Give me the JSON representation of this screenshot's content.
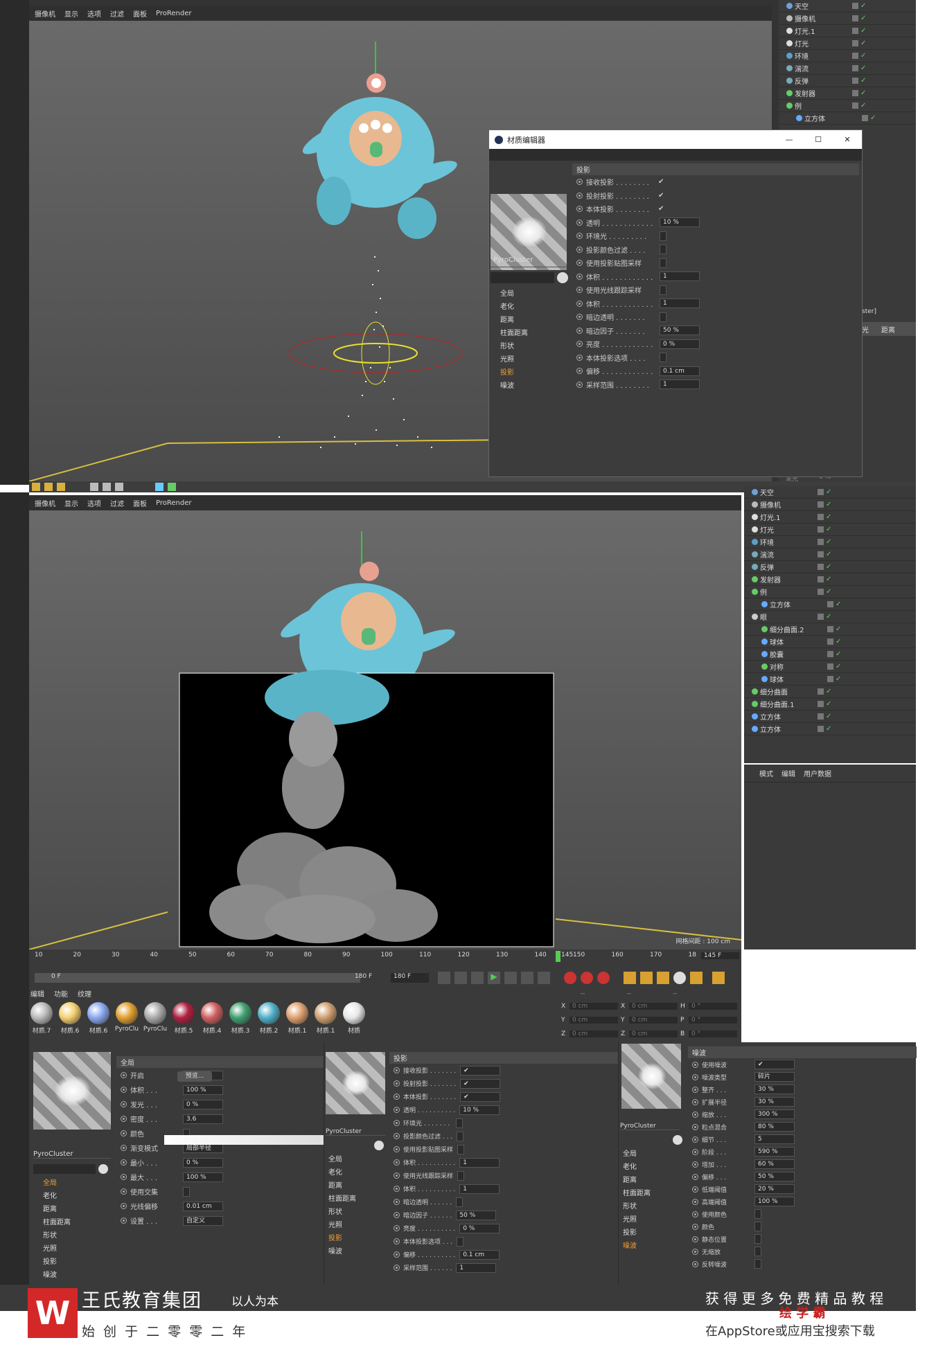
{
  "menu": [
    "摄像机",
    "显示",
    "选项",
    "过滤",
    "面板",
    "ProRender"
  ],
  "objects_top": [
    {
      "name": "天空",
      "color": "#6fa0d8"
    },
    {
      "name": "摄像机",
      "color": "#bbbbbb"
    },
    {
      "name": "灯光.1",
      "color": "#dddddd"
    },
    {
      "name": "灯光",
      "color": "#dddddd"
    },
    {
      "name": "环境",
      "color": "#5aa0c8"
    },
    {
      "name": "湍流",
      "color": "#7ab"
    },
    {
      "name": "反弹",
      "color": "#7ab"
    },
    {
      "name": "发射器",
      "color": "#6c6"
    },
    {
      "name": "例",
      "color": "#6c6"
    },
    {
      "name": "立方体",
      "color": "#6af"
    }
  ],
  "objects_bottom": [
    {
      "name": "天空",
      "color": "#6fa0d8"
    },
    {
      "name": "摄像机",
      "color": "#bbbbbb"
    },
    {
      "name": "灯光.1",
      "color": "#dddddd"
    },
    {
      "name": "灯光",
      "color": "#dddddd"
    },
    {
      "name": "环境",
      "color": "#5aa0c8"
    },
    {
      "name": "湍流",
      "color": "#7ab"
    },
    {
      "name": "反弹",
      "color": "#7ab"
    },
    {
      "name": "发射器",
      "color": "#6c6"
    },
    {
      "name": "例",
      "color": "#6c6"
    },
    {
      "name": "立方体",
      "color": "#6af"
    },
    {
      "name": "眼",
      "color": "#ccc"
    },
    {
      "name": "细分曲面.2",
      "color": "#6c6"
    },
    {
      "name": "球体",
      "color": "#6af"
    },
    {
      "name": "胶囊",
      "color": "#6af"
    },
    {
      "name": "对称",
      "color": "#6c6"
    },
    {
      "name": "球体",
      "color": "#6af"
    },
    {
      "name": "细分曲面",
      "color": "#6c6"
    },
    {
      "name": "细分曲面.1",
      "color": "#6c6"
    },
    {
      "name": "立方体",
      "color": "#6af"
    },
    {
      "name": "立方体",
      "color": "#6af"
    }
  ],
  "partial_labels": {
    "ster": "ster]",
    "guang": "光",
    "ju": "距离",
    "dist": "距离",
    "fa": "发光",
    "pct": "0 %"
  },
  "mat_editor": {
    "title": "材质编辑器",
    "material_name": "PyroCluster",
    "channels": [
      "全局",
      "老化",
      "距离",
      "柱面距离",
      "形状",
      "光照",
      "投影",
      "噪波"
    ],
    "active_channel": "投影",
    "section": "投影",
    "rows": [
      {
        "label": "接收投影 . . . . . . . .",
        "check": "✔"
      },
      {
        "label": "投射投影 . . . . . . . .",
        "check": "✔"
      },
      {
        "label": "本体投影 . . . . . . . .",
        "check": "✔"
      },
      {
        "label": "透明 . . . . . . . . . . . .",
        "value": "10 %"
      },
      {
        "label": "环境光 . . . . . . . . .",
        "value": ""
      },
      {
        "label": "投影颜色过滤 . . . .",
        "value": ""
      },
      {
        "label": "使用投影贴图采样",
        "value": ""
      },
      {
        "label": "体积 . . . . . . . . . . . .",
        "value": "1"
      },
      {
        "label": "使用光线跟踪采样",
        "value": ""
      },
      {
        "label": "体积 . . . . . . . . . . . .",
        "value": "1"
      },
      {
        "label": "暗边透明 . . . . . . .",
        "value": ""
      },
      {
        "label": "暗边因子 . . . . . . .",
        "value": "50 %"
      },
      {
        "label": "亮度 . . . . . . . . . . . .",
        "value": "0 %"
      },
      {
        "label": "本体投影选项 . . . .",
        "value": ""
      },
      {
        "label": "偏移 . . . . . . . . . . . .",
        "value": "0.1 cm"
      },
      {
        "label": "采样范围 . . . . . . . .",
        "value": "1"
      }
    ]
  },
  "viewport_bottom": {
    "grid_label": "网格间距 : 100 cm"
  },
  "attr_tabs": [
    "模式",
    "编辑",
    "用户数据"
  ],
  "timeline": {
    "ticks": [
      "10",
      "20",
      "30",
      "40",
      "50",
      "60",
      "70",
      "80",
      "90",
      "100",
      "110",
      "120",
      "130",
      "140",
      "150",
      "160",
      "170",
      "18"
    ],
    "marker": "145",
    "current": "0 F",
    "end": "180 F",
    "end2": "180 F",
    "frame_display": "145 F"
  },
  "coords": {
    "rows": [
      {
        "a": "X",
        "av": "0 cm",
        "b": "X",
        "bv": "0 cm",
        "c": "H",
        "cv": "0 °"
      },
      {
        "a": "Y",
        "av": "0 cm",
        "b": "Y",
        "bv": "0 cm",
        "c": "P",
        "cv": "0 °"
      },
      {
        "a": "Z",
        "av": "0 cm",
        "b": "Z",
        "bv": "0 cm",
        "c": "B",
        "cv": "0 °"
      }
    ],
    "header": [
      "--",
      "--",
      "--"
    ]
  },
  "mat_menu": [
    "编辑",
    "功能",
    "纹理"
  ],
  "materials": [
    {
      "name": "材质.7",
      "color": "#bbbbbb"
    },
    {
      "name": "材质.6",
      "color": "#f5d070"
    },
    {
      "name": "材质.6",
      "color": "#8aa8f0"
    },
    {
      "name": "PyroClu",
      "color": "#e0a030"
    },
    {
      "name": "PyroClu",
      "color": "#aaaaaa"
    },
    {
      "name": "材质.5",
      "color": "#b02040"
    },
    {
      "name": "材质.4",
      "color": "#d06060"
    },
    {
      "name": "材质.3",
      "color": "#40a070"
    },
    {
      "name": "材质.2",
      "color": "#50b0c8"
    },
    {
      "name": "材质.1",
      "color": "#e0a070"
    },
    {
      "name": "材质.1",
      "color": "#d0a070"
    },
    {
      "name": "材质",
      "color": "#e8e8e8"
    }
  ],
  "panel1": {
    "name": "PyroCluster",
    "section": "全局",
    "channels": [
      "全局",
      "老化",
      "距离",
      "柱面距离",
      "形状",
      "光照",
      "投影",
      "噪波"
    ],
    "active": "全局",
    "preview_btn": "预览...",
    "rows": [
      {
        "label": "开启",
        "value": "✔"
      },
      {
        "label": "体积 . . .",
        "value": "100 %"
      },
      {
        "label": "发光 . . .",
        "value": "0 %"
      },
      {
        "label": "密度 . . .",
        "value": "3.6"
      },
      {
        "label": "颜色",
        "value": ""
      },
      {
        "label": "渐变模式",
        "value": "局部半径"
      },
      {
        "label": "最小 . . .",
        "value": "0 %"
      },
      {
        "label": "最大 . . .",
        "value": "100 %"
      },
      {
        "label": "使用交集",
        "value": ""
      },
      {
        "label": "光线偏移",
        "value": "0.01 cm"
      },
      {
        "label": "设置 . . .",
        "value": "自定义"
      }
    ]
  },
  "panel2": {
    "name": "PyroCluster",
    "section": "投影",
    "channels": [
      "全局",
      "老化",
      "距离",
      "柱面距离",
      "形状",
      "光照",
      "投影",
      "噪波"
    ],
    "active": "投影",
    "rows": [
      {
        "label": "接收投影 . . . . . . .",
        "value": "✔"
      },
      {
        "label": "投射投影 . . . . . . .",
        "value": "✔"
      },
      {
        "label": "本体投影 . . . . . . .",
        "value": "✔"
      },
      {
        "label": "透明 . . . . . . . . . .",
        "value": "10 %"
      },
      {
        "label": "环境光 . . . . . . .",
        "value": ""
      },
      {
        "label": "投影颜色过滤 . . .",
        "value": ""
      },
      {
        "label": "使用投影贴图采样",
        "value": ""
      },
      {
        "label": "体积 . . . . . . . . . .",
        "value": "1"
      },
      {
        "label": "使用光线跟踪采样",
        "value": ""
      },
      {
        "label": "体积 . . . . . . . . . .",
        "value": "1"
      },
      {
        "label": "暗边透明 . . . . . .",
        "value": ""
      },
      {
        "label": "暗边因子 . . . . . .",
        "value": "50 %"
      },
      {
        "label": "亮度 . . . . . . . . . .",
        "value": "0 %"
      },
      {
        "label": "本体投影选项 . . .",
        "value": ""
      },
      {
        "label": "偏移 . . . . . . . . . .",
        "value": "0.1 cm"
      },
      {
        "label": "采样范围 . . . . . .",
        "value": "1"
      }
    ]
  },
  "panel3": {
    "name": "PyroCluster",
    "section": "噪波",
    "channels": [
      "全局",
      "老化",
      "距离",
      "柱面距离",
      "形状",
      "光照",
      "投影",
      "噪波"
    ],
    "active": "噪波",
    "rows": [
      {
        "label": "使用噪波",
        "value": "✔"
      },
      {
        "label": "噪波类型",
        "value": "碎片"
      },
      {
        "label": "整齐 . . .",
        "value": "30 %"
      },
      {
        "label": "扩展半径",
        "value": "30 %"
      },
      {
        "label": "缩放 . . .",
        "value": "300 %"
      },
      {
        "label": "粒点混合",
        "value": "80 %"
      },
      {
        "label": "细节 . . .",
        "value": "5"
      },
      {
        "label": "阶段 . . .",
        "value": "590 %"
      },
      {
        "label": "增加 . . .",
        "value": "60 %"
      },
      {
        "label": "偏移 . . .",
        "value": "50 %"
      },
      {
        "label": "低端阈值",
        "value": "20 %"
      },
      {
        "label": "高端阈值",
        "value": "100 %"
      },
      {
        "label": "使用颜色",
        "value": ""
      },
      {
        "label": "颜色",
        "value": ""
      },
      {
        "label": "静态位置",
        "value": ""
      },
      {
        "label": "无缩放",
        "value": ""
      },
      {
        "label": "反转噪波",
        "value": ""
      }
    ]
  },
  "watermark": {
    "brand": "王氏教育集团",
    "slogan": "以人为本",
    "founded": "始 创 于 二 零 零 二 年",
    "promo": "获 得 更 多 免 费 精 品 教 程",
    "app": "绘 学 霸",
    "store": "在AppStore或应用宝搜索下载"
  }
}
